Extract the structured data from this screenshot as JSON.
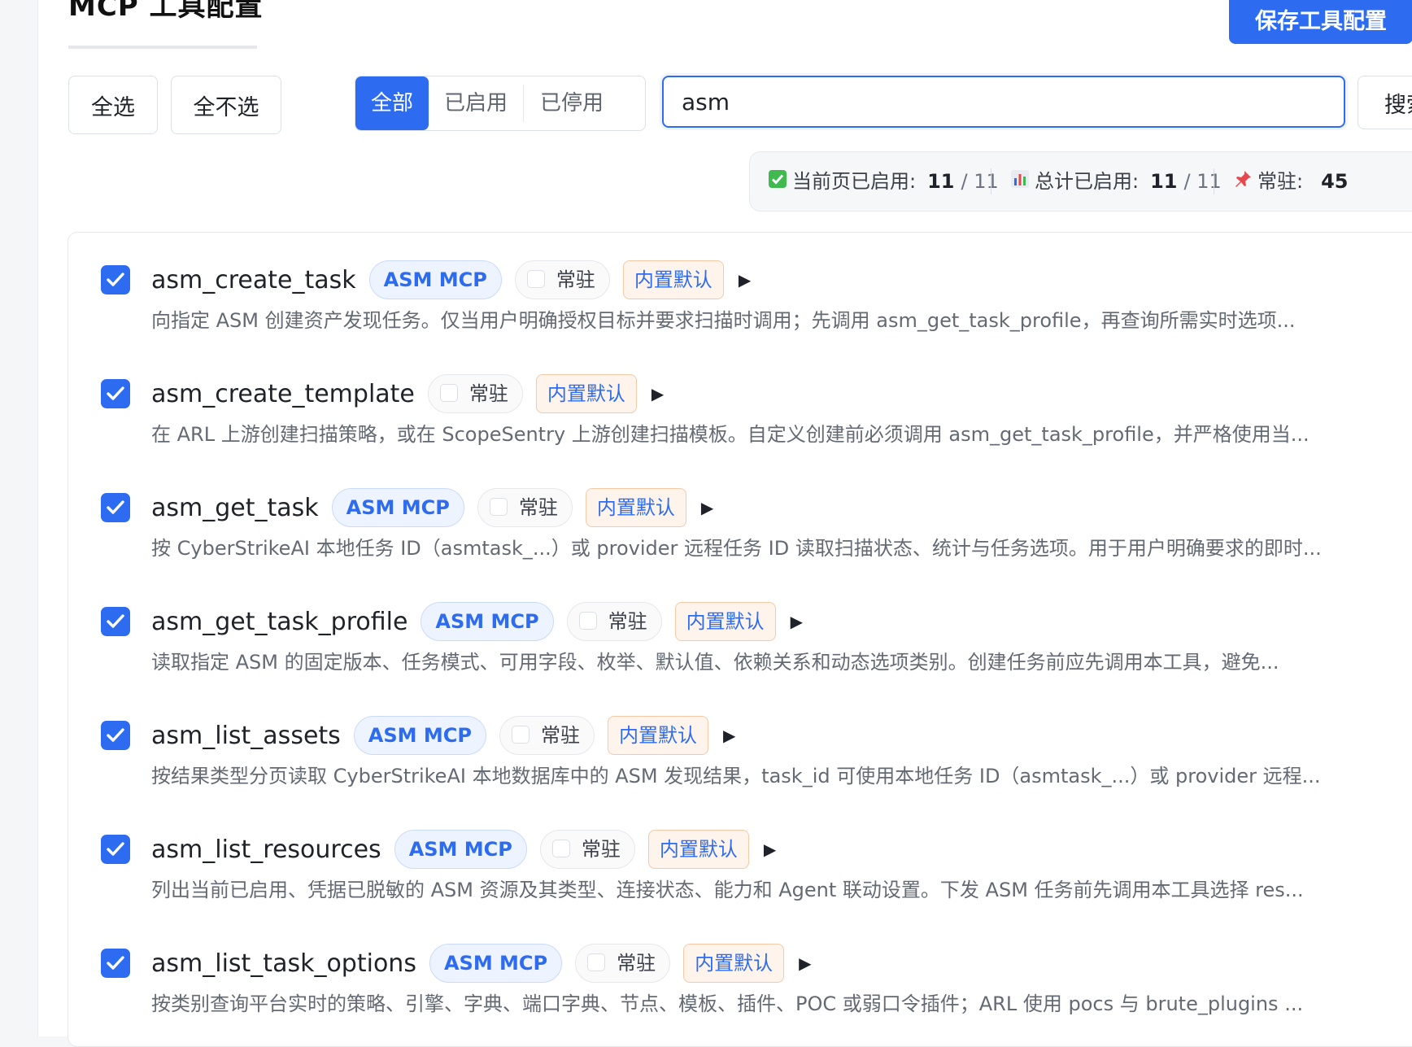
{
  "header": {
    "title": "MCP 工具配置",
    "save_label": "保存工具配置"
  },
  "toolbar": {
    "select_all": "全选",
    "select_none": "全不选",
    "filters": [
      "全部",
      "已启用",
      "已停用"
    ],
    "active_filter": "全部",
    "search_value": "asm",
    "search_label": "搜索"
  },
  "stats": {
    "page_enabled_label": "当前页已启用:",
    "page_enabled": "11",
    "page_total": "/ 11",
    "total_enabled_label": "总计已启用:",
    "total_enabled": "11",
    "total_total": "/ 11",
    "pinned_label": "常驻:",
    "pinned": "45"
  },
  "tools": [
    {
      "name": "asm_create_task",
      "mcp": "ASM MCP",
      "pin": "常驻",
      "default": "内置默认",
      "checked": true,
      "desc": "向指定 ASM 创建资产发现任务。仅当用户明确授权目标并要求扫描时调用；先调用 asm_get_task_profile，再查询所需实时选项..."
    },
    {
      "name": "asm_create_template",
      "mcp": "",
      "pin": "常驻",
      "default": "内置默认",
      "checked": true,
      "desc": "在 ARL 上游创建扫描策略，或在 ScopeSentry 上游创建扫描模板。自定义创建前必须调用 asm_get_task_profile，并严格使用当..."
    },
    {
      "name": "asm_get_task",
      "mcp": "ASM MCP",
      "pin": "常驻",
      "default": "内置默认",
      "checked": true,
      "desc": "按 CyberStrikeAI 本地任务 ID（asmtask_...）或 provider 远程任务 ID 读取扫描状态、统计与任务选项。用于用户明确要求的即时..."
    },
    {
      "name": "asm_get_task_profile",
      "mcp": "ASM MCP",
      "pin": "常驻",
      "default": "内置默认",
      "checked": true,
      "desc": "读取指定 ASM 的固定版本、任务模式、可用字段、枚举、默认值、依赖关系和动态选项类别。创建任务前应先调用本工具，避免..."
    },
    {
      "name": "asm_list_assets",
      "mcp": "ASM MCP",
      "pin": "常驻",
      "default": "内置默认",
      "checked": true,
      "desc": "按结果类型分页读取 CyberStrikeAI 本地数据库中的 ASM 发现结果，task_id 可使用本地任务 ID（asmtask_...）或 provider 远程..."
    },
    {
      "name": "asm_list_resources",
      "mcp": "ASM MCP",
      "pin": "常驻",
      "default": "内置默认",
      "checked": true,
      "desc": "列出当前已启用、凭据已脱敏的 ASM 资源及其类型、连接状态、能力和 Agent 联动设置。下发 ASM 任务前先调用本工具选择 res..."
    },
    {
      "name": "asm_list_task_options",
      "mcp": "ASM MCP",
      "pin": "常驻",
      "default": "内置默认",
      "checked": true,
      "desc": "按类别查询平台实时的策略、引擎、字典、端口字典、节点、模板、插件、POC 或弱口令插件；ARL 使用 pocs 与 brute_plugins ..."
    }
  ]
}
